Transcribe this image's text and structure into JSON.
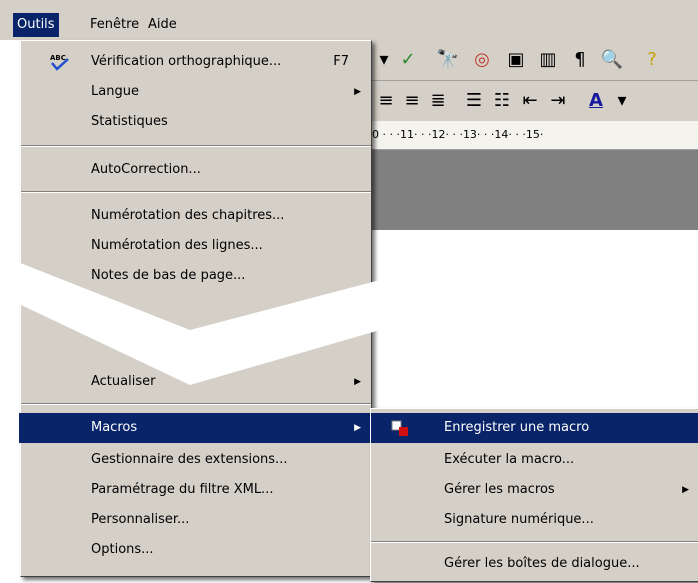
{
  "menubar": {
    "items": [
      {
        "label": "Outils"
      },
      {
        "label": "Fenêtre"
      },
      {
        "label": "Aide"
      }
    ]
  },
  "ruler": {
    "text": "0 · · ·11· · ·12· · ·13· · ·14· · ·15·"
  },
  "tools_menu": {
    "items": [
      {
        "label": "Vérification orthographique...",
        "shortcut": "F7",
        "icon": "abc-check-icon"
      },
      {
        "label": "Langue"
      },
      {
        "label": "Statistiques"
      },
      {
        "label": "AutoCorrection..."
      },
      {
        "label": "Numérotation des chapitres..."
      },
      {
        "label": "Numérotation des lignes..."
      },
      {
        "label": "Notes de bas de page..."
      },
      {
        "label": "Actualiser"
      },
      {
        "label": "Macros"
      },
      {
        "label": "Gestionnaire des extensions..."
      },
      {
        "label": "Paramétrage du filtre XML..."
      },
      {
        "label": "Personnaliser..."
      },
      {
        "label": "Options..."
      }
    ]
  },
  "macros_submenu": {
    "items": [
      {
        "label": "Enregistrer une macro",
        "icon": "record-macro-icon"
      },
      {
        "label": "Exécuter la macro..."
      },
      {
        "label": "Gérer les macros"
      },
      {
        "label": "Signature numérique..."
      },
      {
        "label": "Gérer les boîtes de dialogue..."
      }
    ]
  },
  "colors": {
    "menu_bg": "#d4d0c8",
    "highlight": "#0a246a",
    "highlight_text": "#ffffff"
  }
}
